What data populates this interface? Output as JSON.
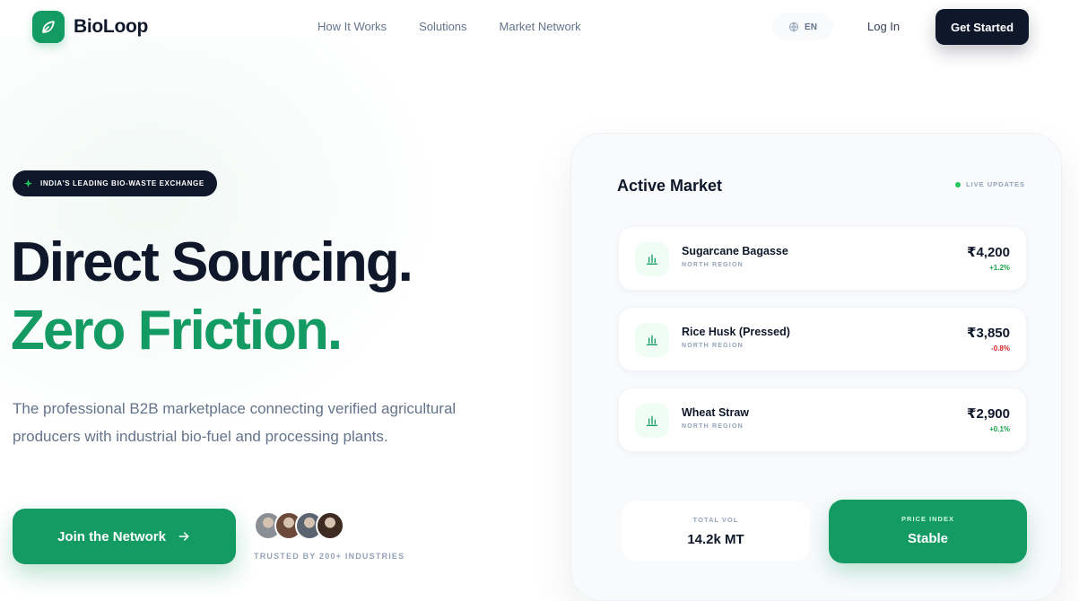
{
  "brand": {
    "name": "BioLoop",
    "accent": "#149a63",
    "dark": "#0f172a"
  },
  "nav": {
    "links": [
      "How It Works",
      "Solutions",
      "Market Network"
    ],
    "language": "EN",
    "login": "Log In",
    "cta": "Get Started"
  },
  "hero": {
    "badge": "INDIA'S LEADING BIO-WASTE EXCHANGE",
    "headline_1": "Direct Sourcing.",
    "headline_2": "Zero Friction.",
    "lead": "The professional B2B marketplace connecting verified agricultural producers with industrial bio-fuel and processing plants.",
    "cta": "Join the Network",
    "cta_icon": "arrow-right-icon",
    "trusted": "TRUSTED BY 200+ INDUSTRIES",
    "avatar_colors": [
      "#8a8f96",
      "#6b4a3a",
      "#5a6470",
      "#3d2b22"
    ]
  },
  "market": {
    "title": "Active Market",
    "live": "LIVE UPDATES",
    "items": [
      {
        "name": "Sugarcane Bagasse",
        "region": "NORTH REGION",
        "price": "₹4,200",
        "change": "+1.2%",
        "trend": "up",
        "icon": "bar-chart-icon"
      },
      {
        "name": "Rice Husk (Pressed)",
        "region": "NORTH REGION",
        "price": "₹3,850",
        "change": "-0.8%",
        "trend": "down",
        "icon": "bar-chart-icon"
      },
      {
        "name": "Wheat Straw",
        "region": "NORTH REGION",
        "price": "₹2,900",
        "change": "+0.1%",
        "trend": "up",
        "icon": "bar-chart-icon"
      }
    ],
    "total_vol": {
      "label": "TOTAL VOL",
      "value": "14.2k MT"
    },
    "price_index": {
      "label": "PRICE INDEX",
      "value": "Stable"
    },
    "colors": {
      "up": "#16a34a",
      "down": "#dc2626"
    }
  }
}
